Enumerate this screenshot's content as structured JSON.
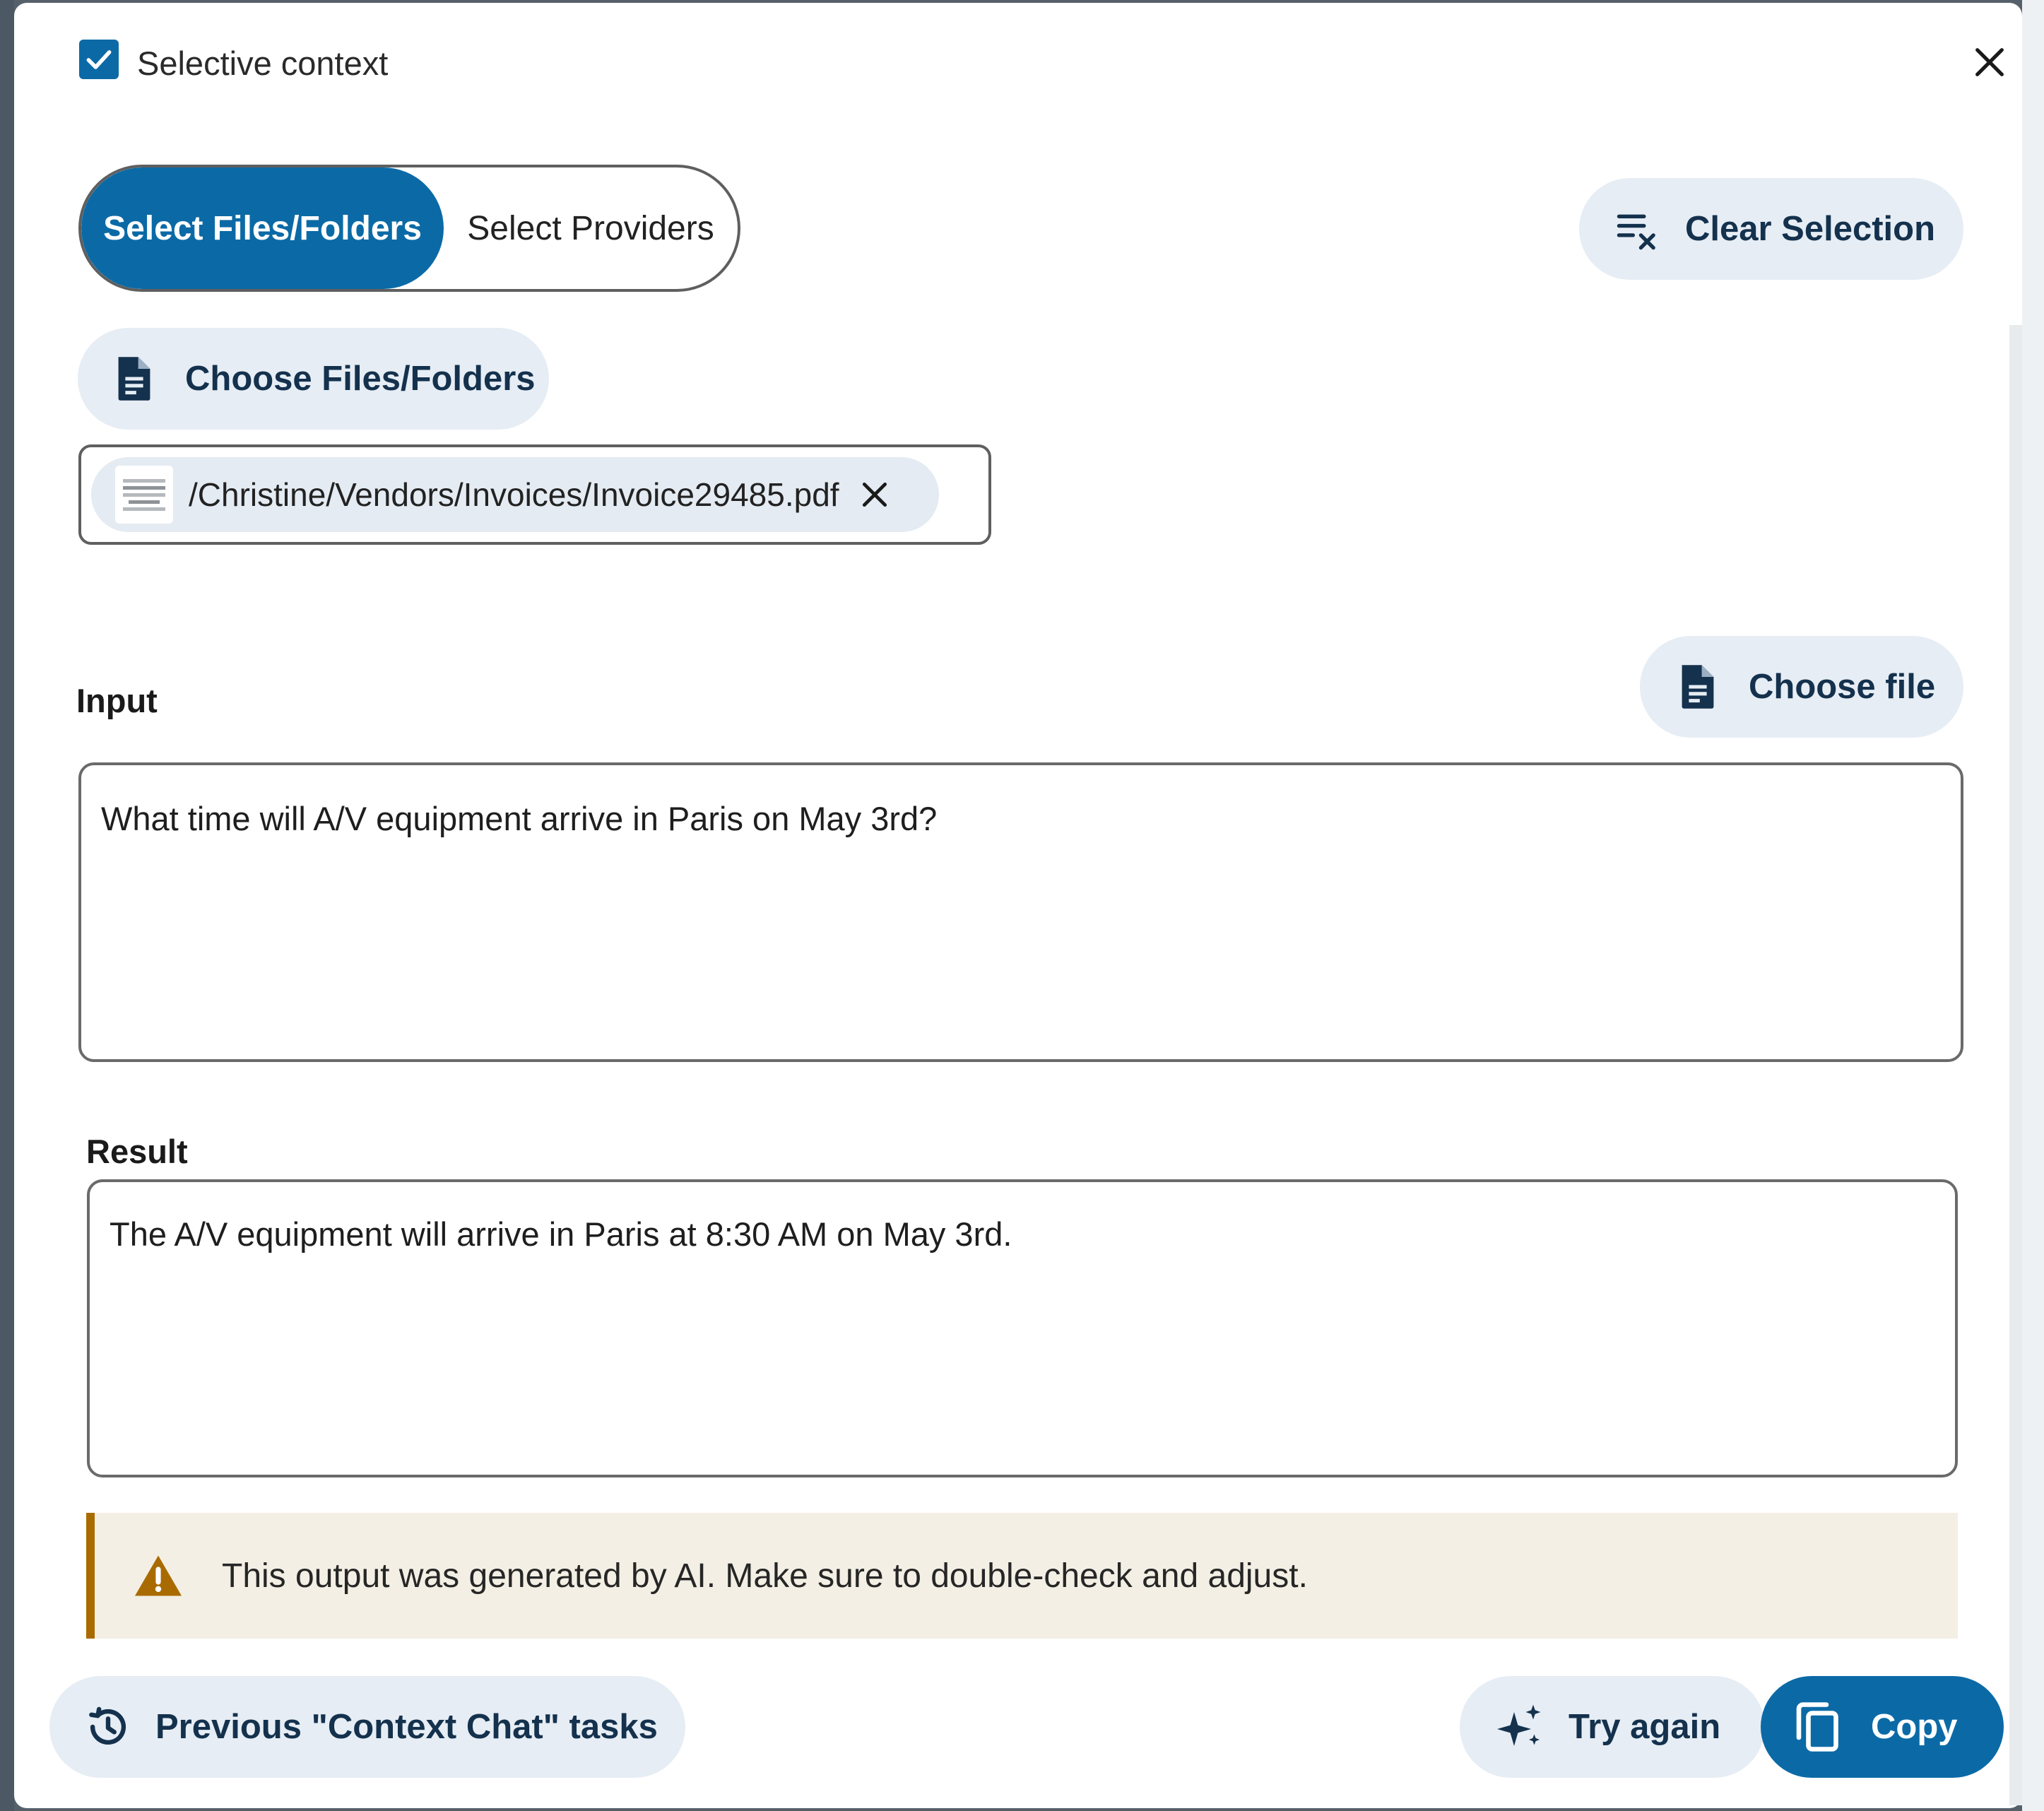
{
  "header": {
    "checkbox_checked": true,
    "checkbox_label": "Selective context",
    "close_icon": "close-icon"
  },
  "tabs": [
    {
      "label": "Select Files/Folders",
      "active": true
    },
    {
      "label": "Select Providers",
      "active": false
    }
  ],
  "toolbar": {
    "clear_selection_label": "Clear Selection",
    "clear_selection_icon": "clear-list-icon",
    "choose_files_label": "Choose Files/Folders",
    "choose_files_icon": "document-icon"
  },
  "selection": {
    "files": [
      {
        "path": "/Christine/Vendors/Invoices/Invoice29485.pdf",
        "icon": "pdf-thumbnail"
      }
    ]
  },
  "input": {
    "label": "Input",
    "choose_file_label": "Choose file",
    "choose_file_icon": "document-icon",
    "value": "What time will A/V equipment arrive in Paris on May 3rd?"
  },
  "result": {
    "label": "Result",
    "value": "The A/V equipment will arrive in Paris at 8:30 AM on May 3rd."
  },
  "warning": {
    "icon": "warning-icon",
    "text": "This output was generated by AI. Make sure to double-check and adjust."
  },
  "footer": {
    "previous_tasks_label": "Previous \"Context Chat\" tasks",
    "previous_tasks_icon": "history-icon",
    "try_again_label": "Try again",
    "try_again_icon": "sparkle-icon",
    "copy_label": "Copy",
    "copy_icon": "copy-icon"
  },
  "colors": {
    "primary": "#0b6aa6",
    "pill_background": "#e6edf4",
    "pill_text": "#14314d",
    "warning_background": "#f3efe4",
    "warning_accent": "#a96b00"
  }
}
